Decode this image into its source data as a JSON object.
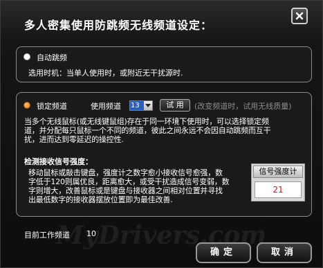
{
  "window": {
    "title": "多人密集使用防跳频无线频道设定："
  },
  "auto_hop": {
    "label": "自动跳频",
    "description": "选用时机：当单人使用时，或附近无干扰源时."
  },
  "lock_channel": {
    "label": "锁定频道",
    "use_channel_label": "使用频道",
    "channel_value": "13",
    "try_button": "试 用",
    "hint": "(改变频道时，试用无线质量)",
    "description_lines": [
      "当多个无线鼠标(或无线键鼠组)存在于同一环境下使用时，可以选择锁定频",
      "道，并分配每只鼠标一个不同的频道，彼此之间永远不会因自动跳频而互干",
      "扰，进而达到零延迟的操控性."
    ]
  },
  "signal": {
    "heading": "检测接收信号强度：",
    "description_lines": [
      "移动鼠标或敲击键盘，强度计之数字愈小接收信号愈强，数",
      "字低于120则属优良，距离愈大，或受干扰造成信号变弱，数",
      "字则增大，改善鼠标或是键盘与接收器之间相对位置并寻找",
      "出最低数字的接收器摆放位置即为最佳改善."
    ],
    "meter_title": "信号强度计",
    "meter_value": "21"
  },
  "footer": {
    "current_channel_label": "目前工作频道",
    "current_channel_value": "10",
    "ok_button": "确定",
    "cancel_button": "取消",
    "watermark": "MyDrivers.com"
  },
  "colors": {
    "background": "#0e0e0e",
    "panel_border": "#8c8c8c",
    "meter_value": "#e01010",
    "selected_radio": "#e07a10",
    "channel_highlight": "#2a5fc0"
  },
  "icons": {
    "close": "close-icon",
    "dropdown": "chevron-down-icon"
  }
}
